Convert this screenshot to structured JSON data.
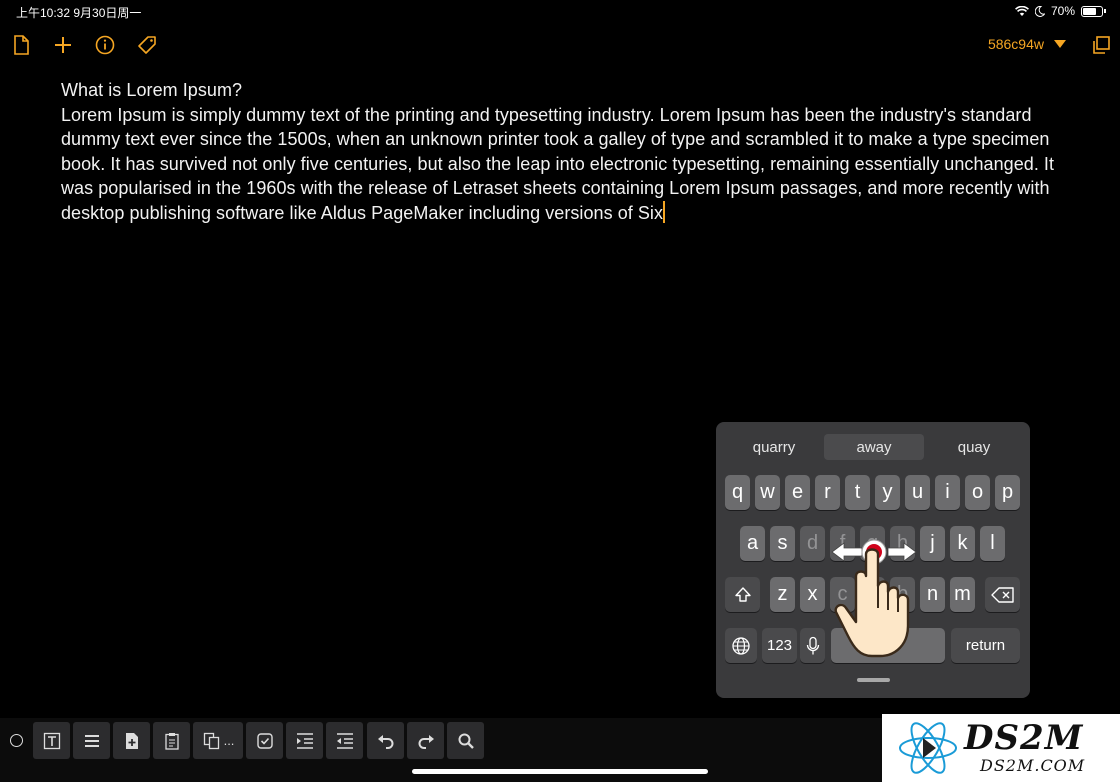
{
  "status_bar": {
    "time_date": "上午10:32   9月30日周一",
    "battery": "70%"
  },
  "toolbar": {
    "doc_id": "586c94w",
    "accent": "#f5a623",
    "icons": [
      "document-icon",
      "plus-icon",
      "info-icon",
      "tag-icon",
      "duplicate-icon"
    ]
  },
  "editor": {
    "title_line": "What is Lorem Ipsum?",
    "body": "Lorem Ipsum is simply dummy text of the printing and typesetting industry. Lorem Ipsum has been the industry's standard dummy text ever since the 1500s, when an unknown printer took a galley of type and scrambled it to make a type specimen book. It has survived not only five centuries, but also the leap into electronic typesetting, remaining essentially unchanged. It was popularised in the 1960s with the release of Letraset sheets containing Lorem Ipsum passages, and more recently with desktop publishing software like Aldus PageMaker including versions of Six"
  },
  "keyboard": {
    "suggestions": [
      "quarry",
      "away",
      "quay"
    ],
    "row1": [
      "q",
      "w",
      "e",
      "r",
      "t",
      "y",
      "u",
      "i",
      "o",
      "p"
    ],
    "row2": [
      "a",
      "s",
      "d",
      "f",
      "g",
      "h",
      "j",
      "k",
      "l"
    ],
    "row3": [
      "z",
      "x",
      "c",
      "v",
      "b",
      "n",
      "m"
    ],
    "numbers_label": "123",
    "return_label": "return"
  },
  "bottom_toolbar": {
    "more_label": "...",
    "icons": [
      "text-frame-icon",
      "list-icon",
      "add-page-icon",
      "clipboard-icon",
      "copy-icon",
      "checkbox-icon",
      "indent-icon",
      "outdent-icon",
      "undo-icon",
      "redo-icon",
      "search-icon"
    ]
  },
  "watermark": {
    "brand": "DS2M",
    "domain": "DS2M.COM"
  }
}
